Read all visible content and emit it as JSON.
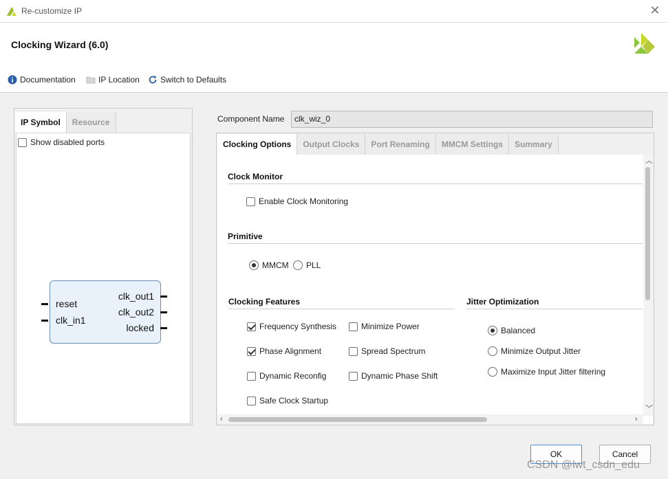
{
  "window": {
    "title": "Re-customize IP",
    "close_icon": "close-icon"
  },
  "header": {
    "title": "Clocking Wizard (6.0)"
  },
  "toolbar": {
    "documentation": "Documentation",
    "ip_location": "IP Location",
    "switch_defaults": "Switch to Defaults"
  },
  "left_panel": {
    "tabs": [
      "IP Symbol",
      "Resource"
    ],
    "show_disabled_ports": "Show disabled ports",
    "symbol": {
      "inputs": [
        "reset",
        "clk_in1"
      ],
      "outputs": [
        "clk_out1",
        "clk_out2",
        "locked"
      ]
    }
  },
  "component": {
    "label": "Component Name",
    "value": "clk_wiz_0"
  },
  "right_panel": {
    "tabs": [
      "Clocking Options",
      "Output Clocks",
      "Port Renaming",
      "MMCM Settings",
      "Summary"
    ],
    "clock_monitor": {
      "title": "Clock Monitor",
      "enable_label": "Enable Clock Monitoring",
      "enabled": false
    },
    "primitive": {
      "title": "Primitive",
      "options": [
        "MMCM",
        "PLL"
      ],
      "selected": "MMCM"
    },
    "clocking_features": {
      "title": "Clocking Features",
      "frequency_synthesis": "Frequency Synthesis",
      "minimize_power": "Minimize Power",
      "phase_alignment": "Phase Alignment",
      "spread_spectrum": "Spread Spectrum",
      "dynamic_reconfig": "Dynamic Reconfig",
      "dynamic_phase_shift": "Dynamic Phase Shift",
      "safe_clock_startup": "Safe Clock Startup"
    },
    "jitter_optimization": {
      "title": "Jitter Optimization",
      "balanced": "Balanced",
      "minimize_output": "Minimize Output Jitter",
      "maximize_input": "Maximize Input Jitter filtering",
      "selected": "Balanced"
    }
  },
  "footer": {
    "ok": "OK",
    "cancel": "Cancel"
  },
  "watermark": "CSDN @lwt_csdn_edu",
  "colors": {
    "brand_green": "#8dc63f",
    "brand_yellow": "#c6d82e",
    "info_blue": "#2b5fa8",
    "block_fill": "#e9f1fa",
    "block_border": "#6a8fb8"
  }
}
